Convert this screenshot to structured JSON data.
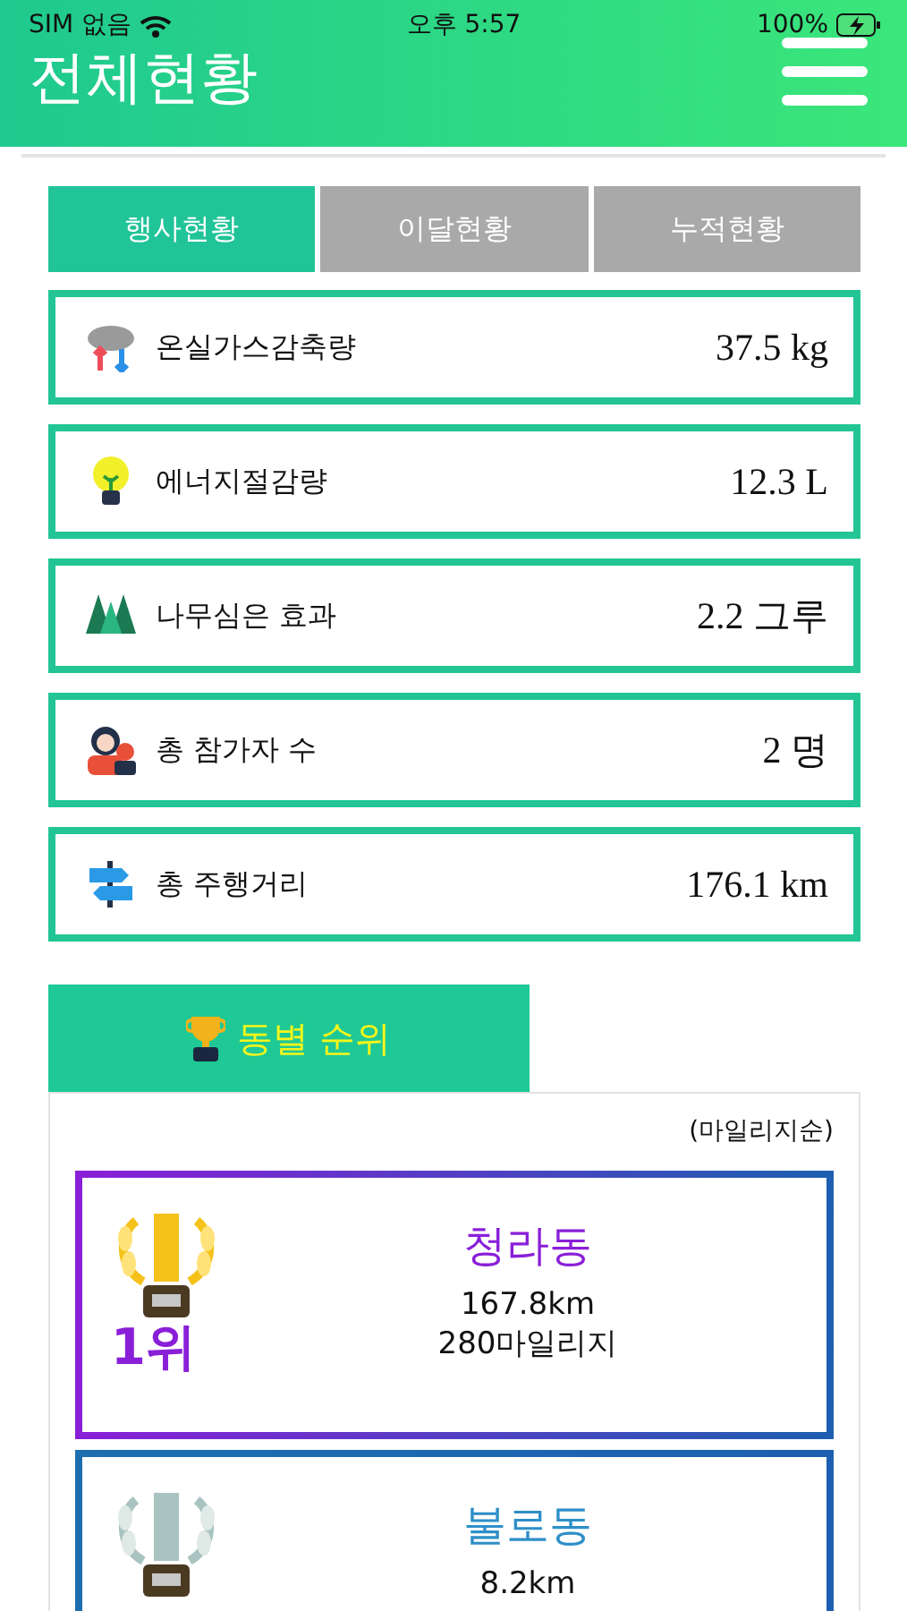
{
  "status_bar": {
    "carrier": "SIM 없음",
    "time": "오후 5:57",
    "battery": "100%"
  },
  "header": {
    "title": "전체현황"
  },
  "tabs": [
    {
      "label": "행사현황",
      "selected": true
    },
    {
      "label": "이달현황",
      "selected": false
    },
    {
      "label": "누적현황",
      "selected": false
    }
  ],
  "stats": [
    {
      "kind": "co2",
      "label": "온실가스감축량",
      "value": "37.5 kg"
    },
    {
      "kind": "energy",
      "label": "에너지절감량",
      "value": "12.3 L"
    },
    {
      "kind": "trees",
      "label": "나무심은 효과",
      "value": "2.2 그루"
    },
    {
      "kind": "people",
      "label": "총 참가자 수",
      "value": "2 명"
    },
    {
      "kind": "distance",
      "label": "총 주행거리",
      "value": "176.1 km"
    }
  ],
  "ranking": {
    "tab": "동별 순위",
    "sort_note": "(마일리지순)",
    "entries": [
      {
        "kind": "gold",
        "color": "#8a1fd8",
        "rank": "1위",
        "name": "청라동",
        "distance": "167.8km",
        "mileage": "280마일리지"
      },
      {
        "kind": "silver",
        "color": "#2e8fc8",
        "name": "불로동",
        "distance": "8.2km"
      }
    ]
  }
}
